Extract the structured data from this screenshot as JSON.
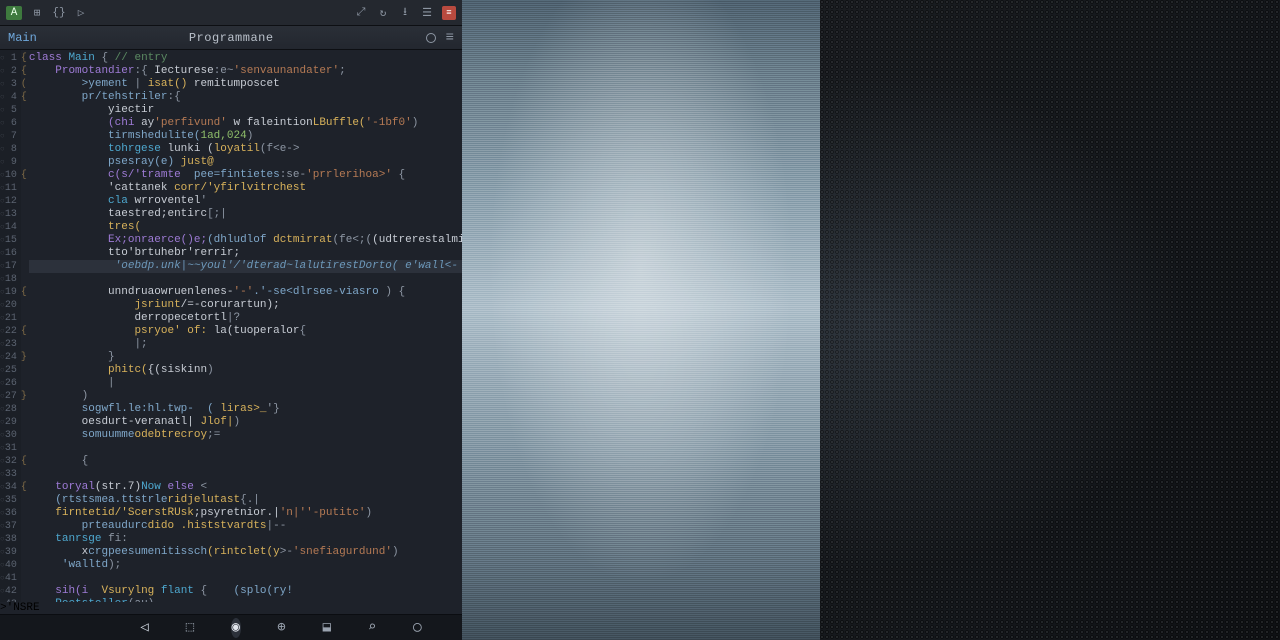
{
  "toolbar": {
    "project_badge": "A",
    "icon2": "⊞",
    "icon3": "{}",
    "icon4": "▷",
    "right": {
      "expand": "⤢",
      "reload": "↻",
      "download": "⭳",
      "save": "☰",
      "doc": "≡"
    }
  },
  "subheader": {
    "left_label": "Main",
    "center_title": "Programmane"
  },
  "code_lines": [
    {
      "i": [
        0,
        "{"
      ],
      "t": [
        [
          "key",
          "class "
        ],
        [
          "type",
          "Main"
        ],
        [
          "op",
          " { "
        ],
        [
          "comment",
          "// entry"
        ]
      ]
    },
    {
      "i": [
        0,
        "{"
      ],
      "t": [
        [
          "key",
          "    Promotandier"
        ],
        [
          "op",
          ":{ "
        ],
        [
          "id",
          "Iecturese"
        ],
        [
          "op",
          ":e~"
        ],
        [
          "str",
          "'senvaunandater'"
        ],
        [
          "op",
          ";"
        ]
      ]
    },
    {
      "i": [
        0,
        "("
      ],
      "t": [
        [
          "id2",
          "        >yement"
        ],
        [
          "op",
          " | "
        ],
        [
          "func",
          "isat()"
        ],
        [
          "id",
          " remitumposcet"
        ]
      ]
    },
    {
      "i": [
        1,
        "{"
      ],
      "t": [
        [
          "id2",
          "        pr/tehstriler"
        ],
        [
          "op",
          ":{"
        ]
      ]
    },
    {
      "i": [
        0,
        ""
      ],
      "t": [
        [
          "id",
          "            yiectir"
        ]
      ]
    },
    {
      "i": [
        0,
        ""
      ],
      "t": [
        [
          "key",
          "            (chi "
        ],
        [
          "id",
          "ay"
        ],
        [
          "str",
          "'perfivund'"
        ],
        [
          "id",
          " w faleintion"
        ],
        [
          "func",
          "LBuffle("
        ],
        [
          "str",
          "'-1bf0'"
        ],
        [
          "op",
          ")"
        ]
      ]
    },
    {
      "i": [
        1,
        ""
      ],
      "t": [
        [
          "id2",
          "            tirmshedulite("
        ],
        [
          "num",
          "1ad,024"
        ],
        [
          "op",
          ")"
        ]
      ]
    },
    {
      "i": [
        0,
        ""
      ],
      "t": [
        [
          "type",
          "            tohrgese "
        ],
        [
          "id",
          "lunki ("
        ],
        [
          "func",
          "loyatil"
        ],
        [
          "op",
          "(f<e->"
        ]
      ]
    },
    {
      "i": [
        0,
        ""
      ],
      "t": [
        [
          "id2",
          "            psesray(e) "
        ],
        [
          "func",
          "just@"
        ]
      ]
    },
    {
      "i": [
        0,
        "{"
      ],
      "t": [
        [
          "key",
          "            c(s/'tramte  "
        ],
        [
          "id2",
          "pee=fintietes"
        ],
        [
          "op",
          ":se-"
        ],
        [
          "str",
          "'prrlerihoa>'"
        ],
        [
          "op",
          " {"
        ]
      ]
    },
    {
      "i": [
        0,
        ""
      ],
      "t": [
        [
          "id",
          "            'cattanek "
        ],
        [
          "func",
          "corr/'yfirlvitrchest"
        ]
      ]
    },
    {
      "i": [
        0,
        ""
      ],
      "t": [
        [
          "type",
          "            cla "
        ],
        [
          "id",
          "wrroventel"
        ],
        [
          "op",
          "'"
        ]
      ]
    },
    {
      "i": [
        0,
        ""
      ],
      "t": [
        [
          "id",
          "            taestred;entirc"
        ],
        [
          "op",
          "[;|"
        ]
      ]
    },
    {
      "i": [
        0,
        ""
      ],
      "t": [
        [
          "func",
          "            tres("
        ]
      ]
    },
    {
      "i": [
        0,
        ""
      ],
      "t": [
        [
          "key",
          "            Ex;onraerce()e;"
        ],
        [
          "id2",
          "(dhludlof"
        ],
        [
          "func",
          " dctmirrat"
        ],
        [
          "op",
          "(fe<;("
        ],
        [
          "id",
          "(udtrerestalmian+{"
        ],
        [
          "op",
          ">"
        ]
      ]
    },
    {
      "i": [
        1,
        ""
      ],
      "t": [
        [
          "id",
          "            tto'brtuhebr'rerrir;"
        ]
      ]
    },
    {
      "i": [
        0,
        ""
      ],
      "t": [
        [
          "warn",
          "             'oebdp.unk|~~youl'/'dterad~lalutirestDorto( e'wall<-"
        ]
      ],
      "hl": true
    },
    {
      "i": [
        0,
        ""
      ],
      "t": [
        [
          "op",
          " "
        ]
      ]
    },
    {
      "i": [
        0,
        "{"
      ],
      "t": [
        [
          "id",
          "            unndruaowruenlenes-"
        ],
        [
          "str",
          "'-'"
        ],
        [
          "id2",
          ".'-se<dlrsee-viasro"
        ],
        [
          "op",
          " ) {"
        ]
      ]
    },
    {
      "i": [
        0,
        ""
      ],
      "t": [
        [
          "func",
          "                jsriunt"
        ],
        [
          "id",
          "/=-corurartun);"
        ]
      ]
    },
    {
      "i": [
        0,
        ""
      ],
      "t": [
        [
          "id",
          "                derropecetortl"
        ],
        [
          "op",
          "|?"
        ]
      ]
    },
    {
      "i": [
        0,
        "{"
      ],
      "t": [
        [
          "func",
          "                psryoe' of: "
        ],
        [
          "id",
          "la(tuoperalor"
        ],
        [
          "op",
          "{"
        ]
      ]
    },
    {
      "i": [
        0,
        ""
      ],
      "t": [
        [
          "op",
          "                |;"
        ]
      ]
    },
    {
      "i": [
        0,
        "}"
      ],
      "t": [
        [
          "op",
          "            }"
        ]
      ]
    },
    {
      "i": [
        0,
        ""
      ],
      "t": [
        [
          "func",
          "            phitc("
        ],
        [
          "id",
          "{(siskinn"
        ],
        [
          "op",
          ")"
        ]
      ]
    },
    {
      "i": [
        0,
        ""
      ],
      "t": [
        [
          "op",
          "            |"
        ]
      ]
    },
    {
      "i": [
        0,
        "}"
      ],
      "t": [
        [
          "op",
          "        )"
        ]
      ]
    },
    {
      "i": [
        0,
        ""
      ],
      "t": [
        [
          "id2",
          "        sogwfl.le:hl.twp-  ( "
        ],
        [
          "func",
          "liras>_"
        ],
        [
          "op",
          "'}"
        ]
      ]
    },
    {
      "i": [
        0,
        ""
      ],
      "t": [
        [
          "id",
          "        oesdurt-veranatl| "
        ],
        [
          "func",
          "Jlof|"
        ],
        [
          "op",
          ")"
        ]
      ]
    },
    {
      "i": [
        0,
        ""
      ],
      "t": [
        [
          "id2",
          "        somuumme"
        ],
        [
          "func",
          "odebtrecroy"
        ],
        [
          "op",
          ";="
        ]
      ]
    },
    {
      "i": [
        0,
        ""
      ],
      "t": [
        [
          "op",
          " "
        ]
      ]
    },
    {
      "i": [
        0,
        "{"
      ],
      "t": [
        [
          "op",
          "        {"
        ]
      ]
    },
    {
      "i": [
        0,
        ""
      ],
      "t": [
        [
          "op",
          " "
        ]
      ]
    },
    {
      "i": [
        1,
        "{"
      ],
      "t": [
        [
          "key",
          "    toryal"
        ],
        [
          "id",
          "(str.7)"
        ],
        [
          "type",
          "Now "
        ],
        [
          "key",
          "else "
        ],
        [
          "op",
          "<"
        ]
      ]
    },
    {
      "i": [
        1,
        ""
      ],
      "t": [
        [
          "id2",
          "    (rtstsmea.ttstrle"
        ],
        [
          "func",
          "ridjelutast"
        ],
        [
          "op",
          "{.|"
        ]
      ]
    },
    {
      "i": [
        1,
        ""
      ],
      "t": [
        [
          "func",
          "    firntetid/'ScerstRUsk"
        ],
        [
          "id",
          ";psyretnior.|"
        ],
        [
          "str",
          "'n|''-putitc'"
        ],
        [
          "op",
          ")"
        ]
      ]
    },
    {
      "i": [
        1,
        ""
      ],
      "t": [
        [
          "id2",
          "        prteaudurc"
        ],
        [
          "func",
          "dido .histstvardts"
        ],
        [
          "op",
          "|--"
        ]
      ]
    },
    {
      "i": [
        0,
        ""
      ],
      "t": [
        [
          "type",
          "    tanrsge "
        ],
        [
          "op",
          "fi:"
        ]
      ]
    },
    {
      "i": [
        0,
        ""
      ],
      "t": [
        [
          "id",
          "        x"
        ],
        [
          "id2",
          "crgpeesumenitissch"
        ],
        [
          "func",
          "(rintclet(y"
        ],
        [
          "op",
          ">-"
        ],
        [
          "str",
          "'snefiagurdund'"
        ],
        [
          "op",
          ")"
        ]
      ]
    },
    {
      "i": [
        0,
        ""
      ],
      "t": [
        [
          "id2",
          "     'walltd"
        ],
        [
          "op",
          ");"
        ]
      ]
    },
    {
      "i": [
        0,
        ""
      ],
      "t": [
        [
          "op",
          " "
        ]
      ]
    },
    {
      "i": [
        1,
        ""
      ],
      "t": [
        [
          "key",
          "    sih(i  "
        ],
        [
          "func",
          "Vsurylng "
        ],
        [
          "type",
          "flant "
        ],
        [
          "op",
          "{    "
        ],
        [
          "id2",
          "(splo(ry!"
        ]
      ]
    },
    {
      "i": [
        1,
        ""
      ],
      "t": [
        [
          "type",
          "    Pectstellor"
        ],
        [
          "op",
          "(au)"
        ]
      ]
    },
    {
      "i": [
        0,
        "}"
      ],
      "t": [
        [
          "op",
          "    }"
        ]
      ]
    }
  ],
  "bottom": {
    "hover_label": ">'NSRE",
    "icons": [
      "◁",
      "⬚",
      "◉",
      "⊕",
      "⬓",
      "⌕",
      "◯"
    ]
  }
}
